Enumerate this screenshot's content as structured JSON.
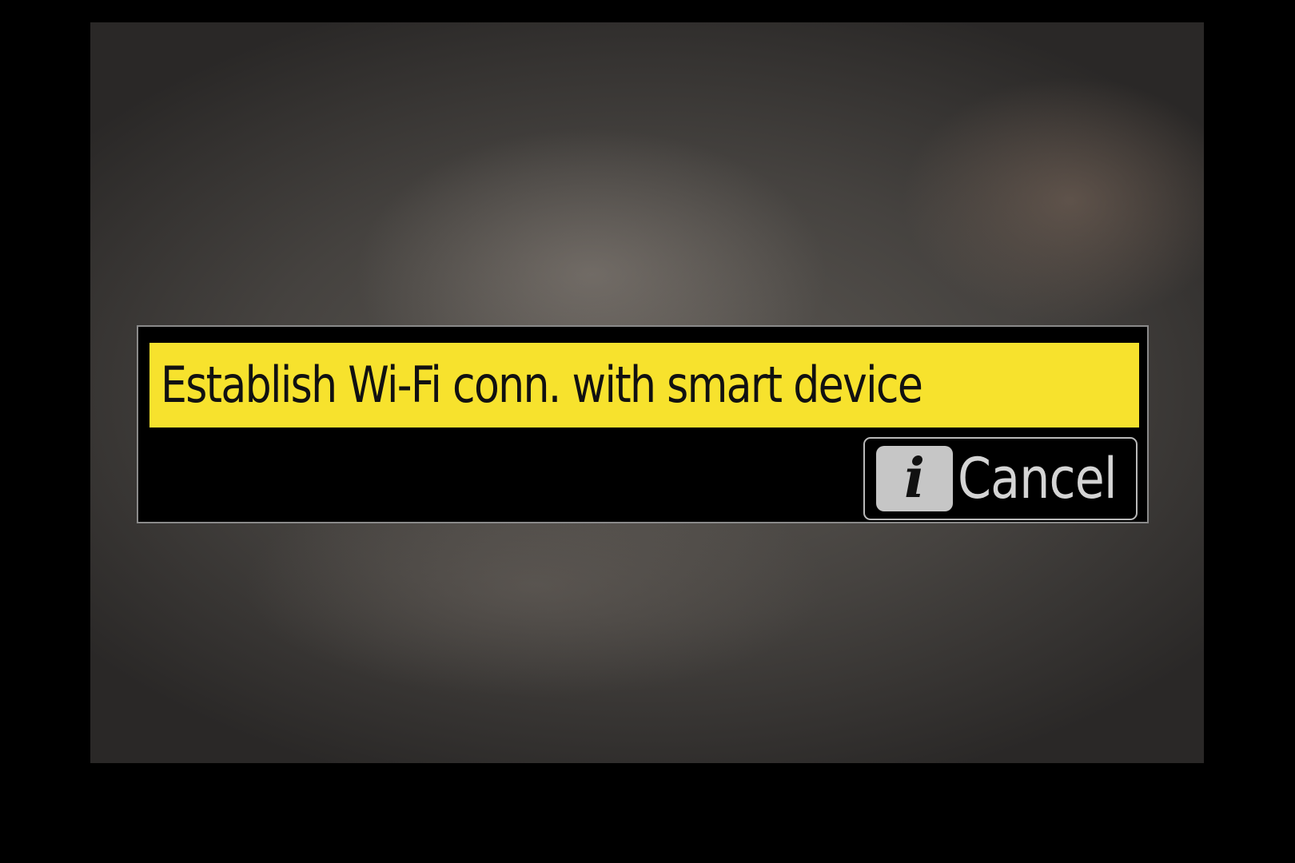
{
  "dialog": {
    "title": "Establish Wi-Fi conn. with smart device",
    "cancel_button": {
      "key_icon": "info-button-icon",
      "key_glyph": "i",
      "label": "Cancel"
    }
  },
  "colors": {
    "title_highlight": "#f7e22d",
    "dialog_background": "#000000",
    "border": "#8a8a8a",
    "key_icon_background": "#c6c6c6"
  }
}
